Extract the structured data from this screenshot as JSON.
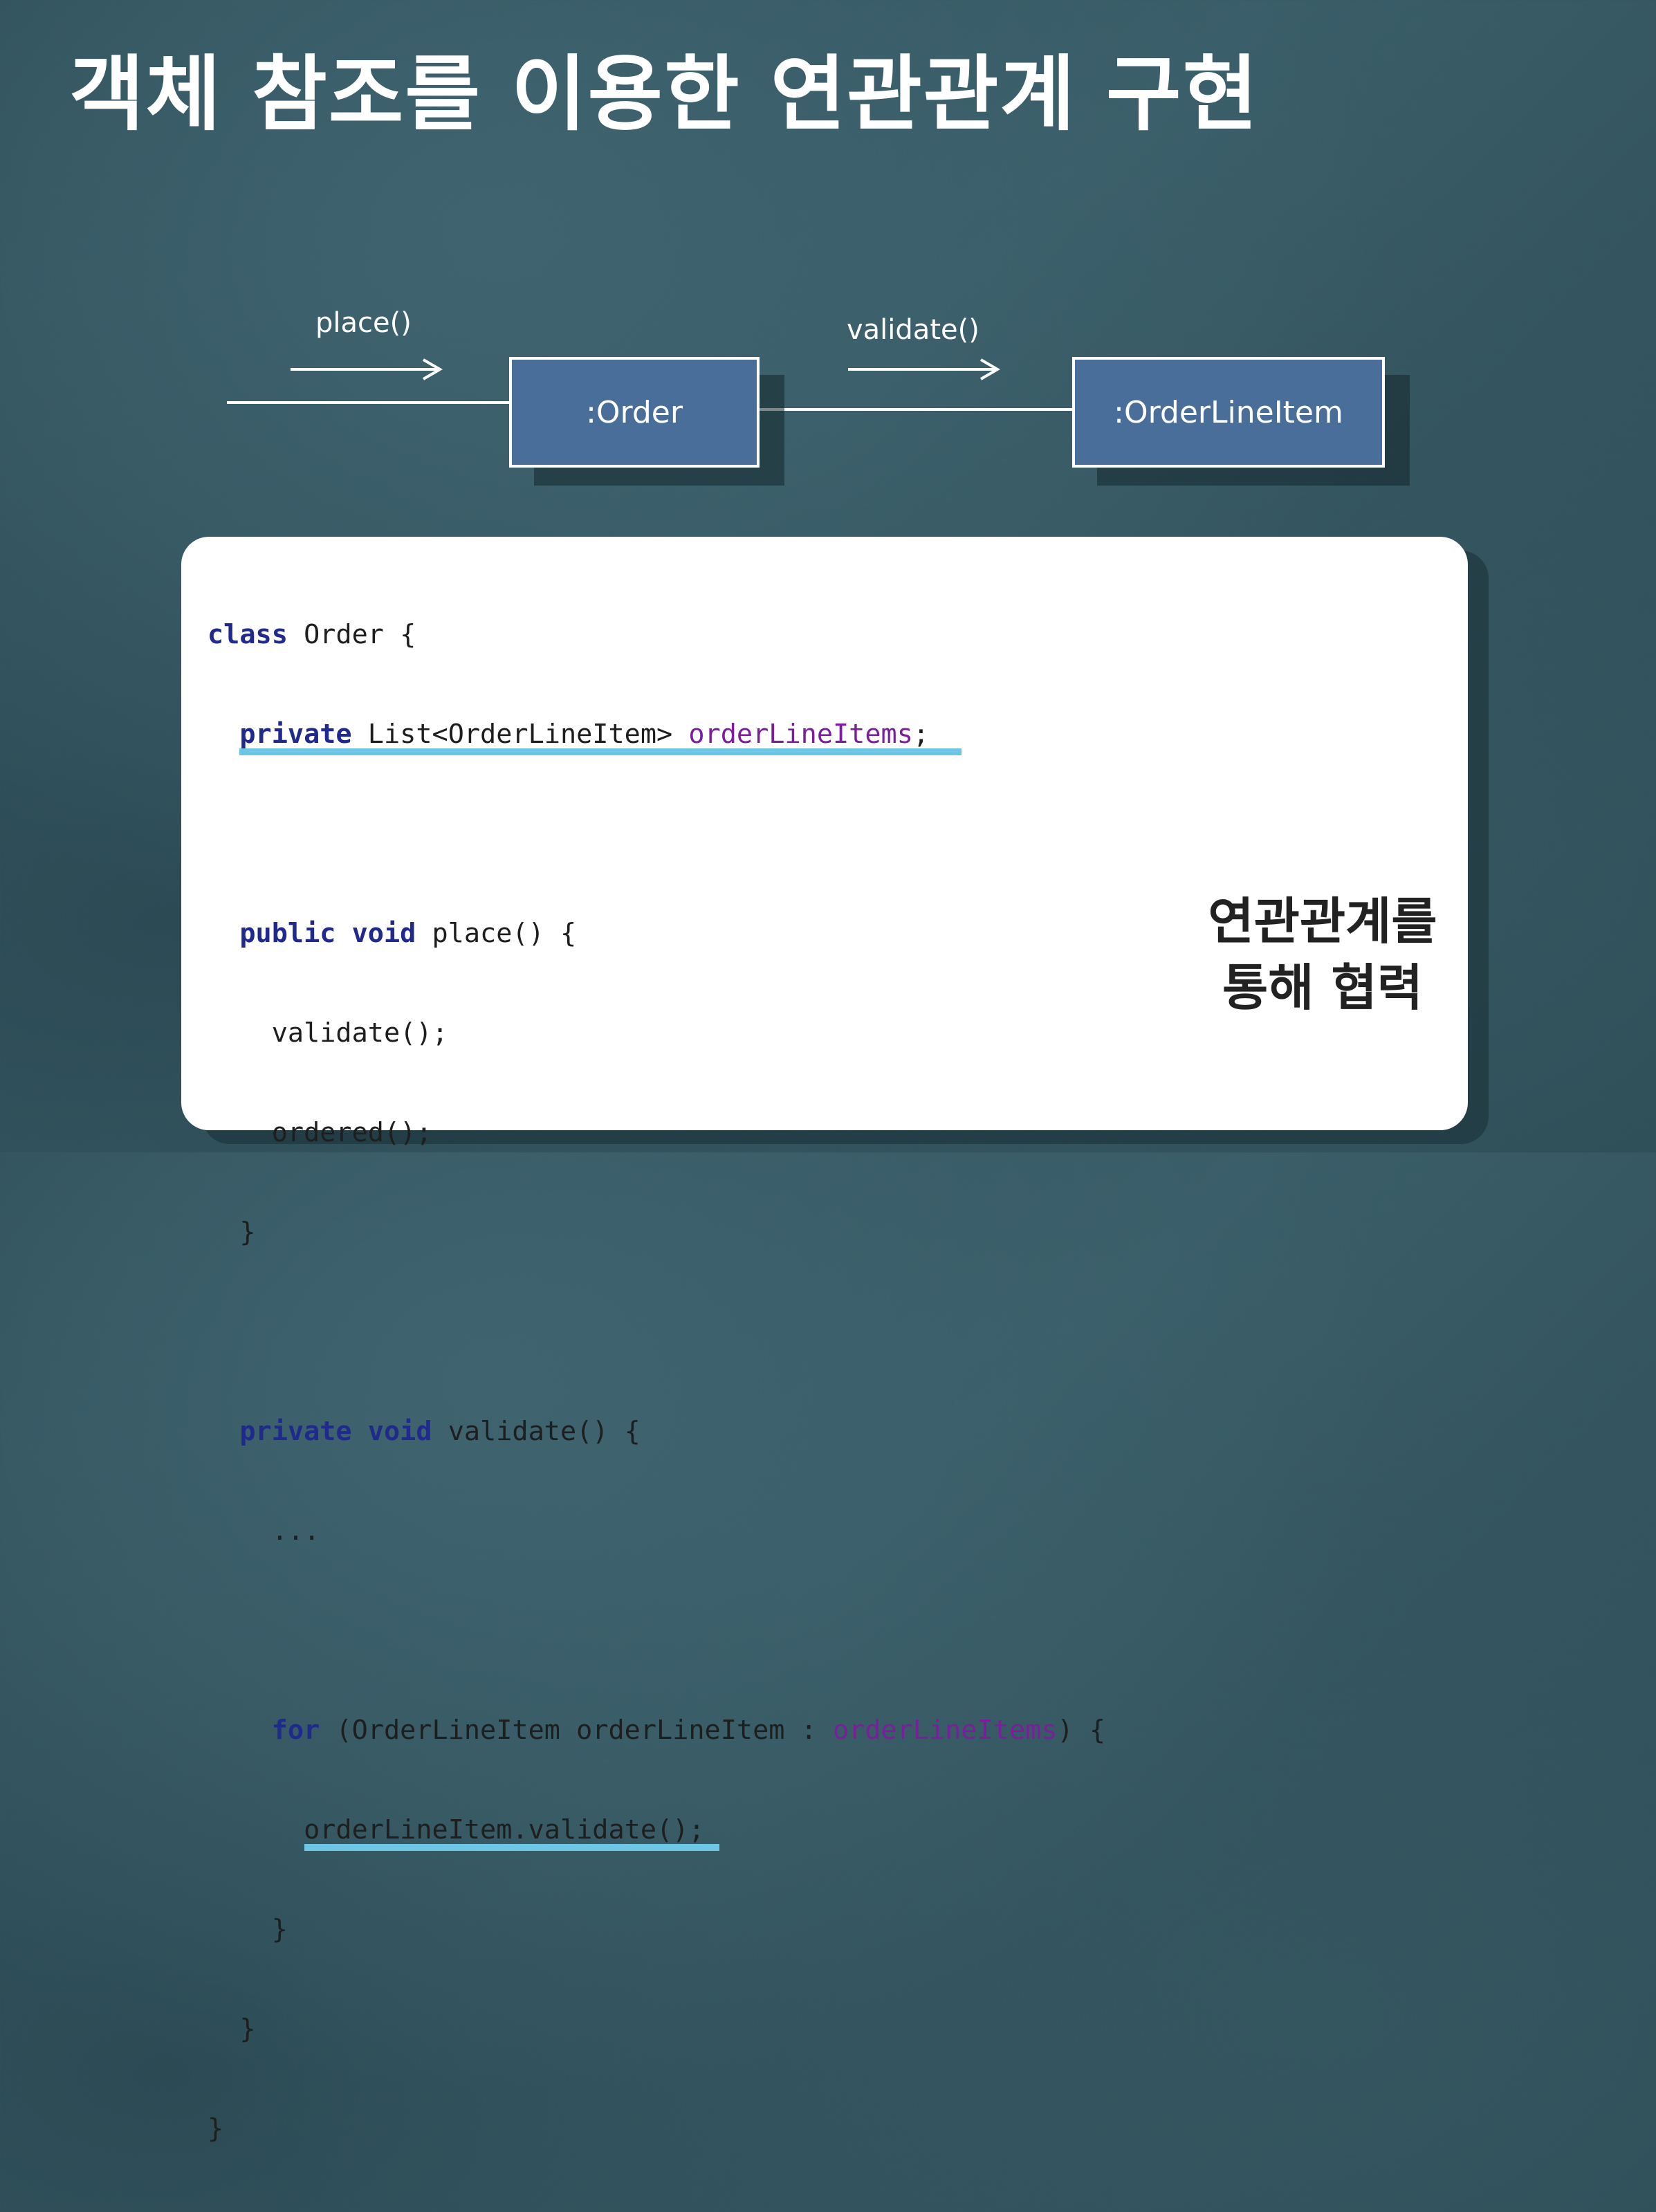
{
  "title": "객체 참조를 이용한 연관관계 구현",
  "diagram": {
    "message_1": "place()",
    "message_2": "validate()",
    "object_1": ":Order",
    "object_2": ":OrderLineItem",
    "box_color": "#4a6e9a"
  },
  "code": {
    "line_01_kw": "class",
    "line_01_text": " Order {",
    "line_02_kw": "private",
    "line_02_text": " List<OrderLineItem> ",
    "line_02_field": "orderLineItems",
    "line_02_end": ";",
    "line_04_kw": "public void",
    "line_04_text": " place() {",
    "line_05_text": "validate();",
    "line_06_text": "ordered();",
    "line_07_text": "}",
    "line_09_kw": "private void",
    "line_09_text": " validate() {",
    "line_10_text": "...",
    "line_12_kw": "for",
    "line_12_text": " (OrderLineItem orderLineItem : ",
    "line_12_field": "orderLineItems",
    "line_12_end": ") {",
    "line_13_text": "orderLineItem.validate();",
    "line_14_text": "}",
    "line_15_text": "}",
    "line_16_text": "}"
  },
  "note": {
    "line_1": "연관관계를",
    "line_2": "통해 협력"
  },
  "colors": {
    "keyword": "#1f2a8c",
    "field": "#7a1e9c",
    "highlight_underline": "#6ec6e6"
  }
}
